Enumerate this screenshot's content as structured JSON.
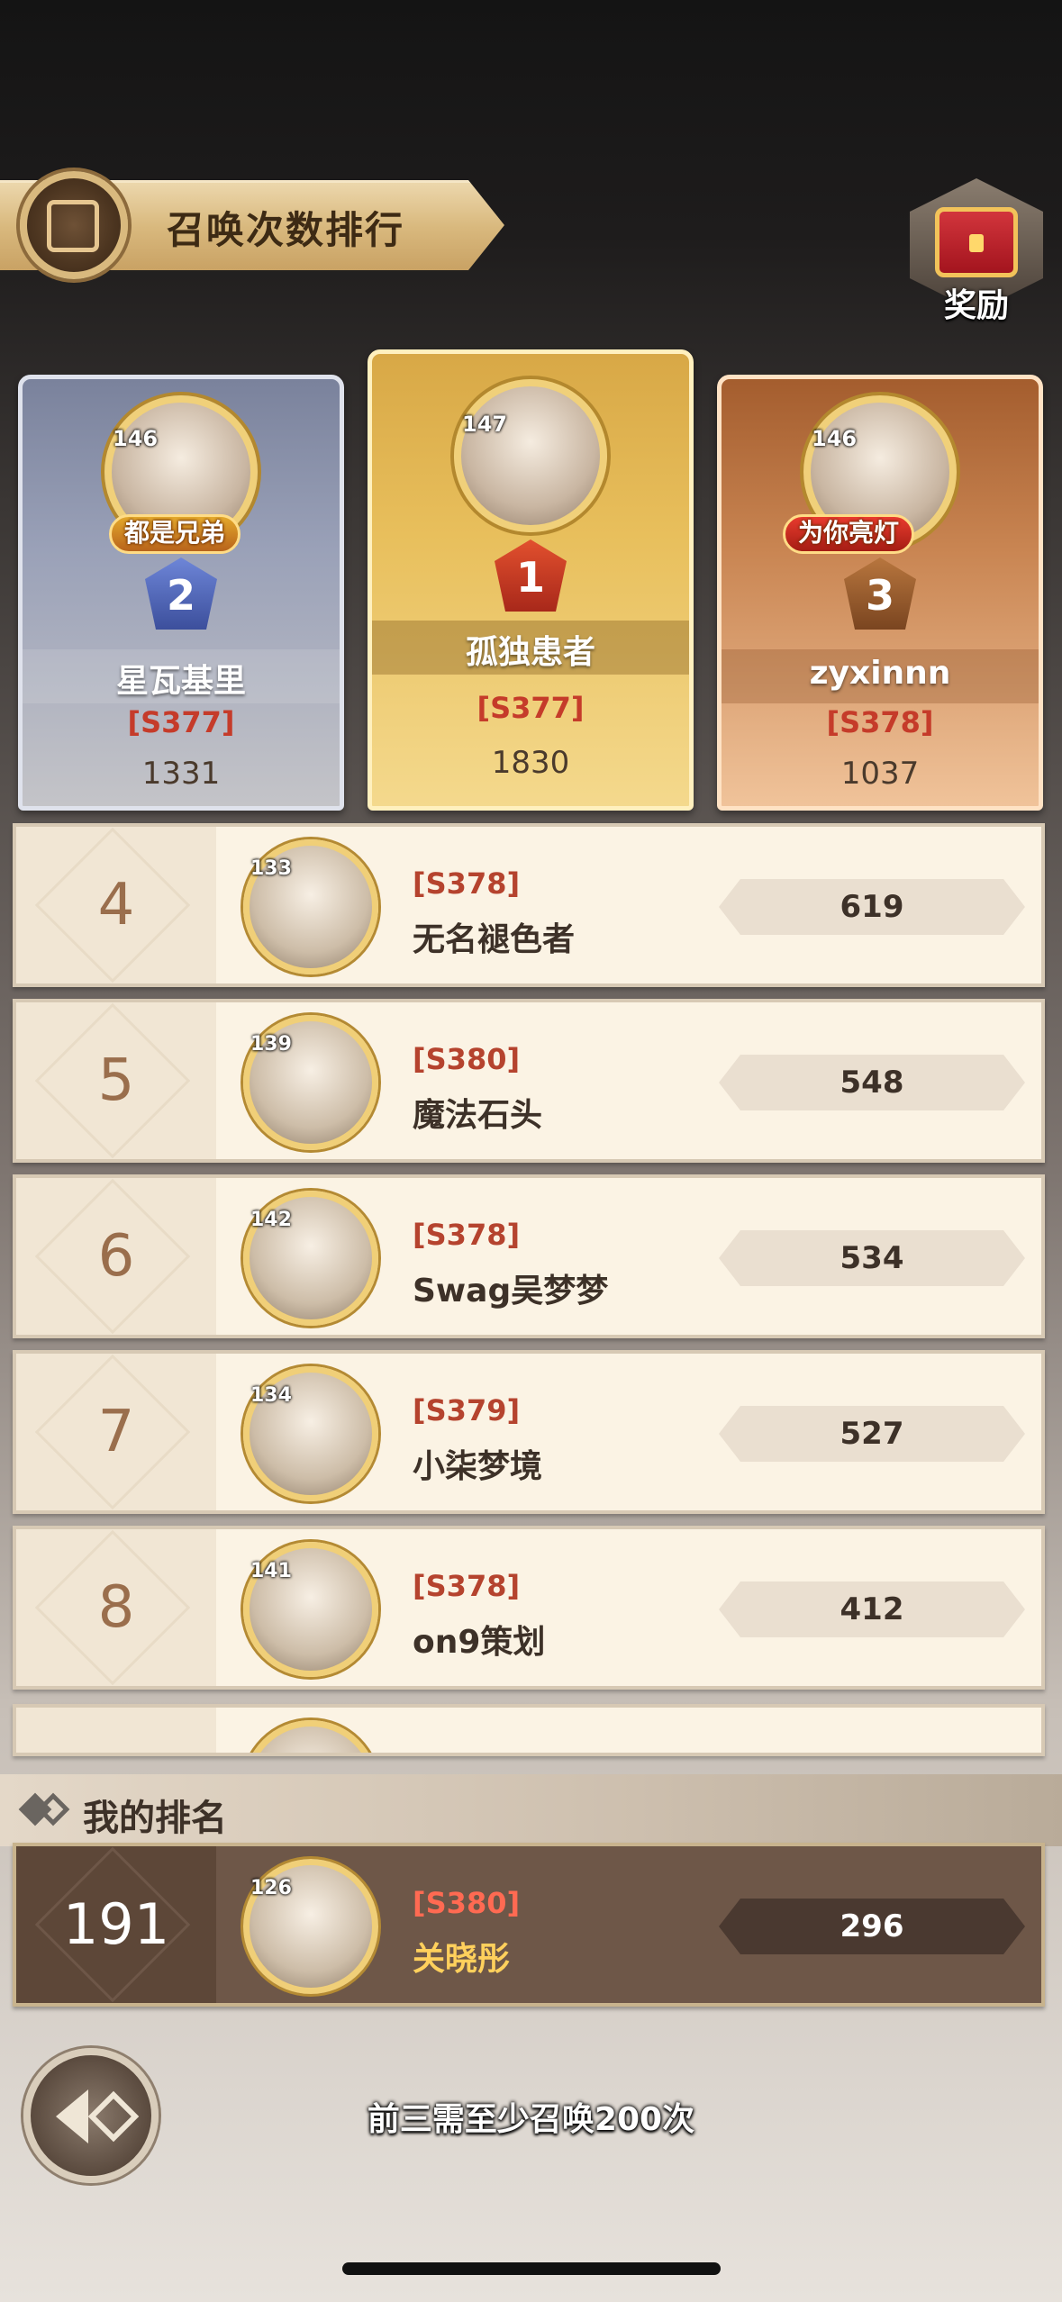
{
  "header": {
    "title": "召唤次数排行"
  },
  "reward": {
    "label": "奖励"
  },
  "podium": [
    {
      "rank": "2",
      "level": "146",
      "title": "都是兄弟",
      "name": "星瓦基里",
      "server": "[S377]",
      "score": "1331"
    },
    {
      "rank": "1",
      "level": "147",
      "title": "",
      "name": "孤独患者",
      "server": "[S377]",
      "score": "1830"
    },
    {
      "rank": "3",
      "level": "146",
      "title": "为你亮灯",
      "name": "zyxinnn",
      "server": "[S378]",
      "score": "1037"
    }
  ],
  "rankings": [
    {
      "rank": "4",
      "level": "133",
      "server": "[S378]",
      "name": "无名褪色者",
      "score": "619"
    },
    {
      "rank": "5",
      "level": "139",
      "server": "[S380]",
      "name": "魔法石头",
      "score": "548"
    },
    {
      "rank": "6",
      "level": "142",
      "server": "[S378]",
      "name": "Swag吴梦梦",
      "score": "534"
    },
    {
      "rank": "7",
      "level": "134",
      "server": "[S379]",
      "name": "小柒梦境",
      "score": "527"
    },
    {
      "rank": "8",
      "level": "141",
      "server": "[S378]",
      "name": "on9策划",
      "score": "412"
    }
  ],
  "my_rank": {
    "label": "我的排名",
    "rank": "191",
    "level": "126",
    "server": "[S380]",
    "name": "关晓彤",
    "score": "296"
  },
  "footer": {
    "hint": "前三需至少召唤200次"
  },
  "colors": {
    "gold": "#e8bf5c",
    "silver": "#9aa1b8",
    "bronze": "#c98552",
    "server_red": "#b5432e",
    "my_name_yellow": "#ffd05c"
  }
}
